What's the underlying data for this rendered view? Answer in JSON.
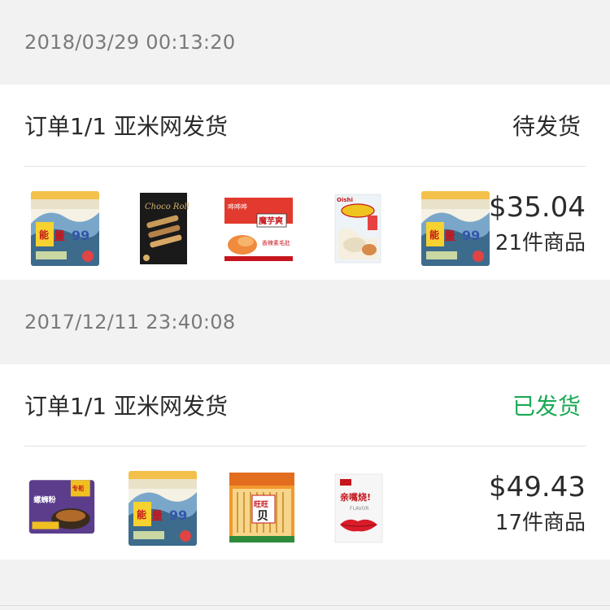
{
  "orders": [
    {
      "date": "2018/03/29 00:13:20",
      "title": "订单1/1 亚米网发货",
      "status": "待发货",
      "status_color": "#2b2b2b",
      "price": "$35.04",
      "count": "21件商品",
      "items": [
        {
          "name": "snack-bag-energy-99-icon",
          "label": "能量99"
        },
        {
          "name": "choco-roll-box-icon",
          "label": "Choco Roll"
        },
        {
          "name": "moyushuang-box-icon",
          "label": "魔芋爽"
        },
        {
          "name": "oishi-shrimp-chips-icon",
          "label": "Oishi"
        },
        {
          "name": "snack-bag-energy-99-icon",
          "label": "能量99"
        }
      ]
    },
    {
      "date": "2017/12/11 23:40:08",
      "title": "订单1/1 亚米网发货",
      "status": "已发货",
      "status_color": "#1aaa55",
      "price": "$49.43",
      "count": "17件商品",
      "items": [
        {
          "name": "rice-noodle-bag-icon",
          "label": "螺蛳粉"
        },
        {
          "name": "snack-bag-energy-99-icon",
          "label": "能量99"
        },
        {
          "name": "wangwang-crackers-bag-icon",
          "label": "旺旺"
        },
        {
          "name": "qinzuijian-bag-icon",
          "label": "亲嘴烧"
        }
      ]
    }
  ]
}
